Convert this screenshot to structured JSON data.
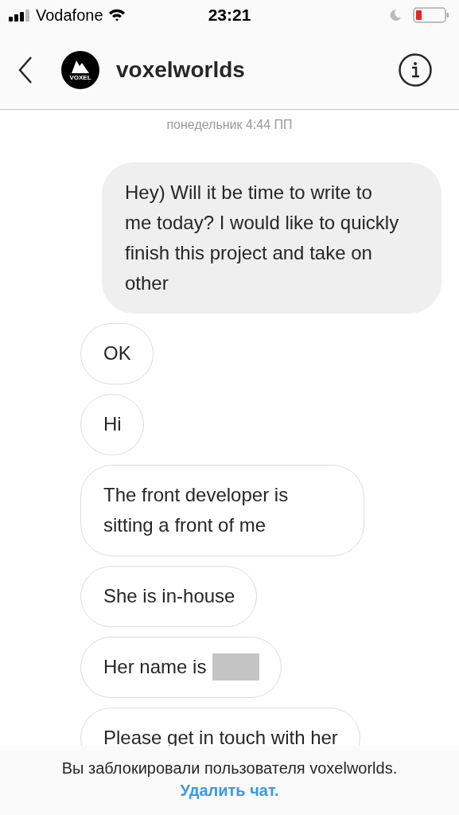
{
  "status_bar": {
    "carrier": "Vodafone",
    "time": "23:21",
    "battery_low": true
  },
  "header": {
    "title": "voxelworlds",
    "avatar_label": "VOXEL"
  },
  "timestamp": "понедельник 4:44 ПП",
  "messages": [
    {
      "kind": "outgoing",
      "text": "Hey) Will it be time to write to me today?  I would like to quickly finish this project and take on other",
      "redacted": false
    },
    {
      "kind": "incoming",
      "text": "OK",
      "redacted": false
    },
    {
      "kind": "incoming",
      "text": "Hi",
      "redacted": false
    },
    {
      "kind": "incoming",
      "text": "The front developer is sitting a front of me",
      "redacted": false
    },
    {
      "kind": "incoming",
      "text": "She is in-house",
      "redacted": false
    },
    {
      "kind": "incoming",
      "text": "Her name is",
      "redacted": true
    },
    {
      "kind": "incoming",
      "text": "Please get in touch with her",
      "redacted": false
    }
  ],
  "banner": {
    "text": "Вы заблокировали пользователя voxelworlds.",
    "link": "Удалить чат."
  }
}
